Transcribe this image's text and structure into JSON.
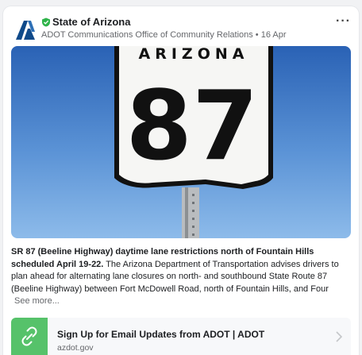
{
  "post": {
    "author": "State of Arizona",
    "meta": "ADOT Communications Office of Community Relations • 16 Apr",
    "more_menu": "···",
    "image": {
      "sign_state": "ARIZONA",
      "sign_number": "87"
    },
    "caption": {
      "headline": "SR 87 (Beeline Highway) daytime lane restrictions north of Fountain Hills scheduled April 19-22.",
      "body": " The Arizona Department of Transportation advises drivers to plan ahead for alternating lane closures on north- and southbound State Route 87 (Beeline Highway) between Fort McDowell Road, north of Fountain Hills, and Four",
      "see_more": "See more..."
    },
    "link_preview": {
      "title": "Sign Up for Email Updates from ADOT | ADOT",
      "domain": "azdot.gov"
    }
  },
  "colors": {
    "verified": "#2fb34a",
    "avatar": "#0f4a8a",
    "link_thumb": "#56c26a",
    "sky_top": "#2a62b5",
    "sky_bottom": "#86b7e8"
  }
}
